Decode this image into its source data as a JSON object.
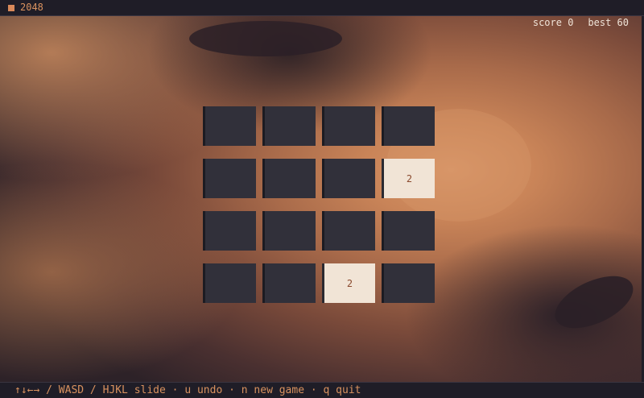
{
  "titlebar": {
    "app_title": "2048",
    "score_text": "score 0",
    "best_text": "best 60"
  },
  "game": {
    "score": 0,
    "best": 60,
    "grid_size": 4,
    "cells": [
      [
        "",
        "",
        "",
        ""
      ],
      [
        "",
        "",
        "",
        "2"
      ],
      [
        "",
        "",
        "",
        ""
      ],
      [
        "",
        "",
        "2",
        ""
      ]
    ]
  },
  "statusbar": {
    "hint": "↑↓←→ / WASD / HJKL slide · u undo · n new game · q quit"
  },
  "colors": {
    "accent": "#d9925f",
    "empty_tile": "#31303a",
    "tile_2": "#f1e4d6",
    "tile_text": "#8a4a2e",
    "bar_bg": "#1f1d27"
  }
}
